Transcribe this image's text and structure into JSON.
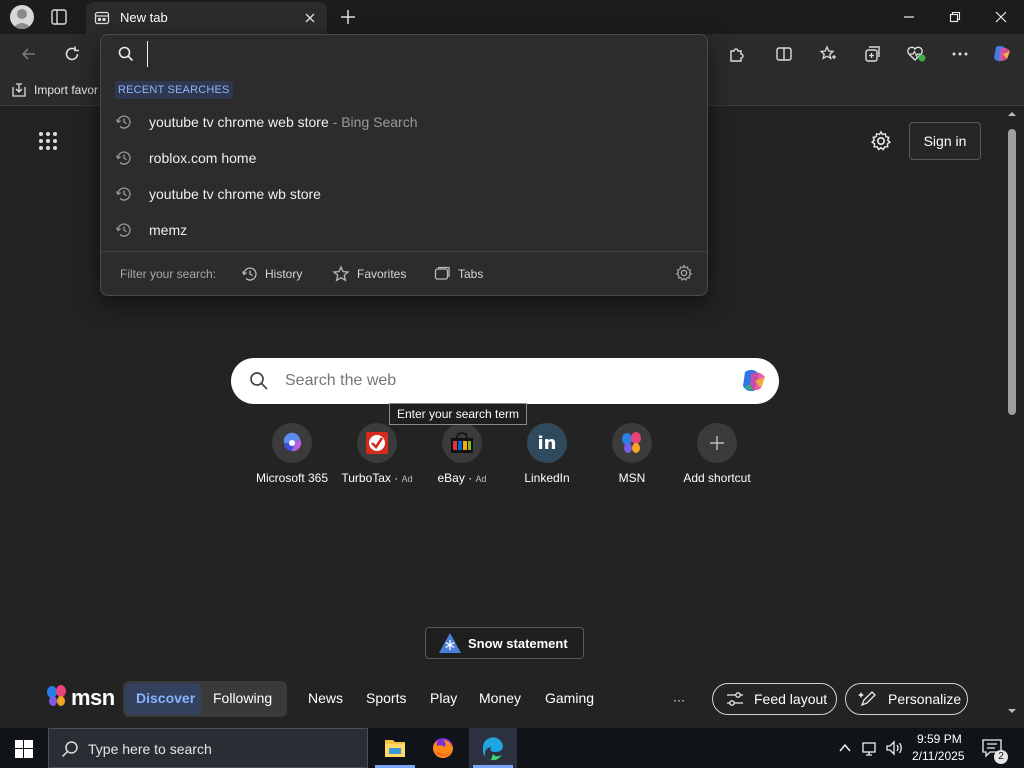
{
  "window": {
    "tab_title": "New tab"
  },
  "toolbar": {
    "address_value": ""
  },
  "favorites_bar": {
    "import_label": "Import favor"
  },
  "dropdown": {
    "section_title": "RECENT SEARCHES",
    "items": [
      {
        "text": "youtube tv chrome web store",
        "suffix": " - Bing Search"
      },
      {
        "text": "roblox.com home",
        "suffix": ""
      },
      {
        "text": "youtube tv chrome wb store",
        "suffix": ""
      },
      {
        "text": "memz",
        "suffix": ""
      }
    ],
    "filter_label": "Filter your search:",
    "filters": [
      "History",
      "Favorites",
      "Tabs"
    ]
  },
  "newtab": {
    "sign_in": "Sign in",
    "search_placeholder": "Search the web",
    "tooltip": "Enter your search term",
    "shortcuts": [
      {
        "label": "Microsoft 365",
        "ad": ""
      },
      {
        "label": "TurboTax",
        "ad": "Ad"
      },
      {
        "label": "eBay",
        "ad": "Ad"
      },
      {
        "label": "LinkedIn",
        "ad": ""
      },
      {
        "label": "MSN",
        "ad": ""
      },
      {
        "label": "Add shortcut",
        "ad": ""
      }
    ],
    "snow_statement": "Snow statement"
  },
  "msn_bar": {
    "brand": "msn",
    "discover": "Discover",
    "following": "Following",
    "nav": [
      "News",
      "Sports",
      "Play",
      "Money",
      "Gaming"
    ],
    "more": "···",
    "feed_layout": "Feed layout",
    "personalize": "Personalize"
  },
  "taskbar": {
    "search_placeholder": "Type here to search",
    "time": "9:59 PM",
    "date": "2/11/2025",
    "notifications": "2"
  }
}
